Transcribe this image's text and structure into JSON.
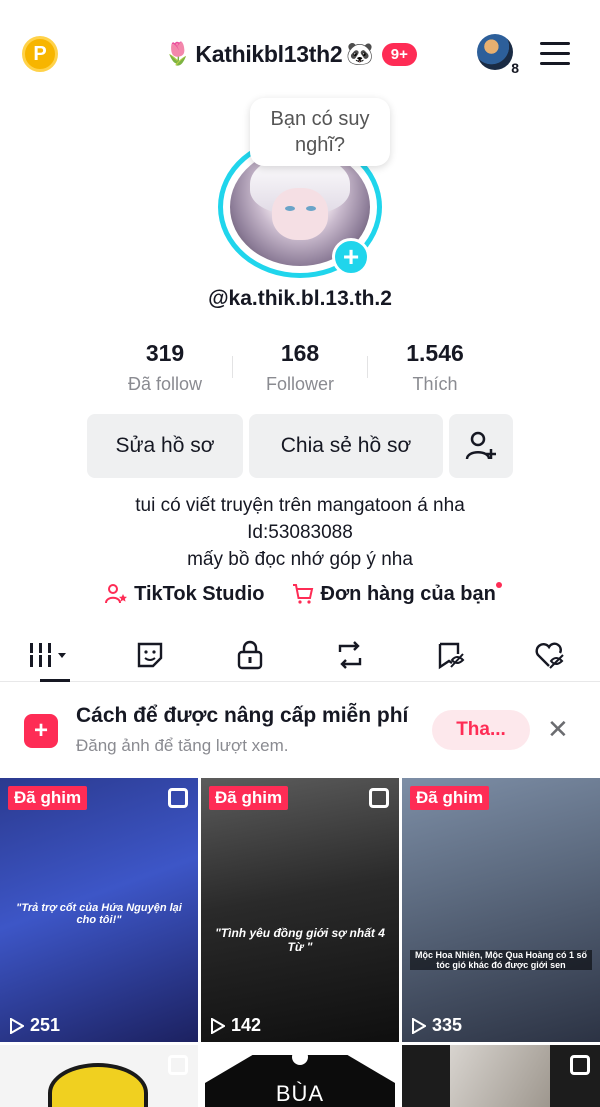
{
  "header": {
    "emoji_left": "🌷",
    "username": "Kathikbl13th2",
    "emoji_right": "🐼",
    "notif_badge": "9+",
    "friends_count": "8",
    "coin_letter": "P"
  },
  "profile": {
    "thought_bubble": "Bạn có suy nghĩ?",
    "handle": "@ka.thik.bl.13.th.2",
    "stats": [
      {
        "value": "319",
        "label": "Đã follow"
      },
      {
        "value": "168",
        "label": "Follower"
      },
      {
        "value": "1.546",
        "label": "Thích"
      }
    ],
    "edit_label": "Sửa hồ sơ",
    "share_label": "Chia sẻ hồ sơ",
    "bio": [
      "tui có viết truyện trên mangatoon á nha",
      "Id:53083088",
      "mấy bồ đọc nhớ góp ý nha"
    ],
    "studio_label": "TikTok Studio",
    "orders_label": "Đơn hàng của bạn"
  },
  "tabs": [
    {
      "icon": "grid-icon"
    },
    {
      "icon": "sticker-icon"
    },
    {
      "icon": "lock-icon"
    },
    {
      "icon": "repost-icon"
    },
    {
      "icon": "favorites-hidden-icon"
    },
    {
      "icon": "liked-hidden-icon"
    }
  ],
  "banner": {
    "title": "Cách để được nâng cấp miễn phí",
    "subtitle": "Đăng ảnh để tăng lượt xem.",
    "button": "Tha..."
  },
  "videos": [
    {
      "pinned": "Đã ghim",
      "views": "251",
      "caption": "\"Trả trợ cốt của Hứa Nguyện lại cho tôi!\""
    },
    {
      "pinned": "Đã ghim",
      "views": "142",
      "caption": "\"Tình yêu đồng giới sợ nhất 4 Từ \""
    },
    {
      "pinned": "Đã ghim",
      "views": "335",
      "caption": "Mộc Hoa Nhiên, Mộc Qua Hoàng có 1 số tóc gió khác đó được giới sen"
    }
  ],
  "row2": {
    "middle_text": "BÙA"
  },
  "colors": {
    "accent": "#fe2c55",
    "ring": "#20d5ec",
    "muted": "#8a8b91"
  }
}
